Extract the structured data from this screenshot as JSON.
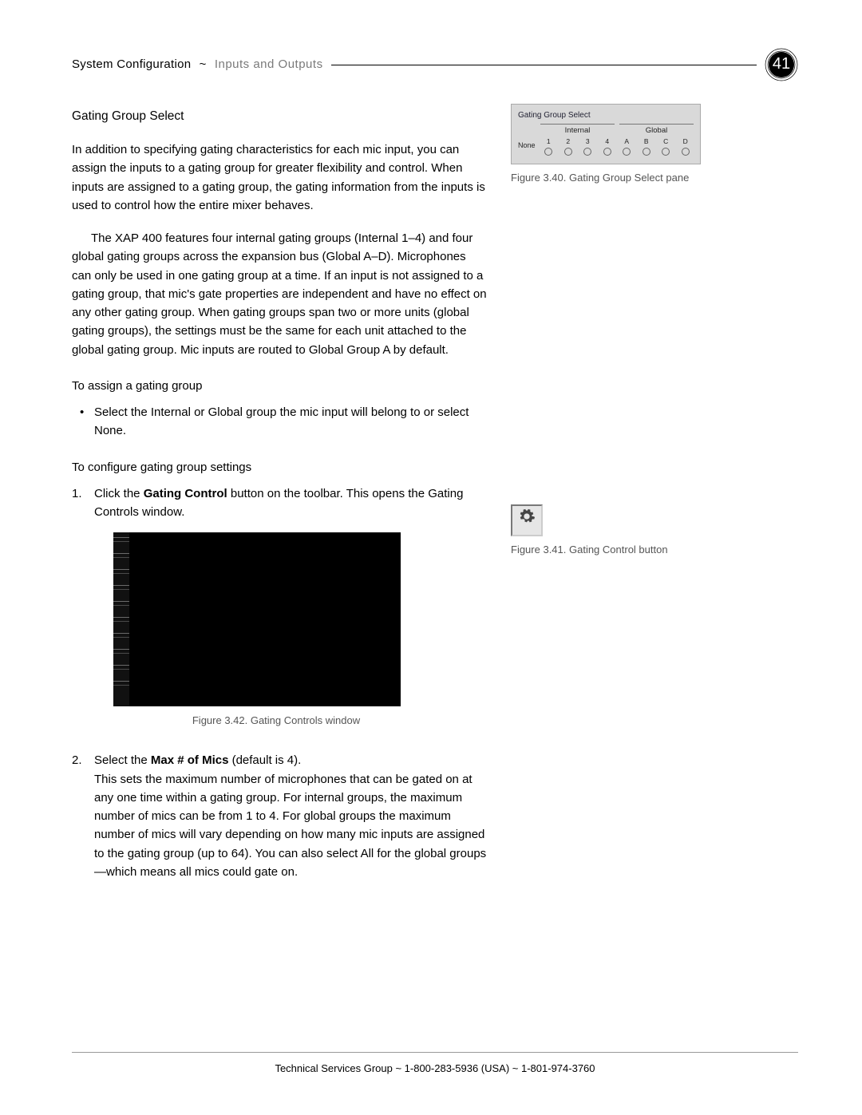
{
  "header": {
    "chapter": "System Configuration",
    "sep": "~",
    "section": "Inputs and Outputs",
    "page_number": "41"
  },
  "content": {
    "h_gating_group_select": "Gating Group Select",
    "p_intro": "In addition to specifying gating characteristics for each mic input, you can assign the inputs to a gating group for greater flexibility and control. When inputs are assigned to a gating group, the gating information from the inputs is used to control how the entire mixer behaves.",
    "p_features": "The XAP 400 features four internal gating groups (Internal 1–4) and four global gating groups across the expansion bus (Global A–D). Microphones can only be used in one gating group at a time. If an input is not assigned to a gating group, that mic's gate properties are independent and have no effect on any other gating group. When gating groups span two or more units (global gating groups), the settings must be the same for each unit attached to the global gating group. Mic inputs are routed to Global Group A by default.",
    "h_assign": "To assign a gating group",
    "li_assign_1": "Select the Internal or Global group the mic input will belong to or select None.",
    "h_configure": "To configure gating group settings",
    "step1_a": "Click the ",
    "step1_bold": "Gating Control",
    "step1_b": " button on the toolbar. This opens the Gating Controls window.",
    "fig342_caption": "Figure 3.42. Gating Controls window",
    "step2_a": "Select the ",
    "step2_bold": "Max # of Mics",
    "step2_b": " (default is 4).",
    "step2_desc": "This sets the maximum number of microphones that can be gated on at any one time within a gating group. For internal groups, the maximum number of mics can be from 1 to 4. For global groups the maximum number of mics will vary depending on how many mic inputs are assigned to the gating group (up to 64). You can also select All for the global groups—which means all mics could gate on."
  },
  "aside": {
    "fig340_caption": "Figure 3.40. Gating Group Select pane",
    "fig341_caption": "Figure 3.41. Gating Control button",
    "ggs_pane": {
      "title": "Gating Group Select",
      "none_label": "None",
      "internal_label": "Internal",
      "global_label": "Global",
      "opts": [
        "1",
        "2",
        "3",
        "4",
        "A",
        "B",
        "C",
        "D"
      ]
    }
  },
  "footer": {
    "text": "Technical Services Group ~ 1-800-283-5936 (USA) ~ 1-801-974-3760"
  }
}
